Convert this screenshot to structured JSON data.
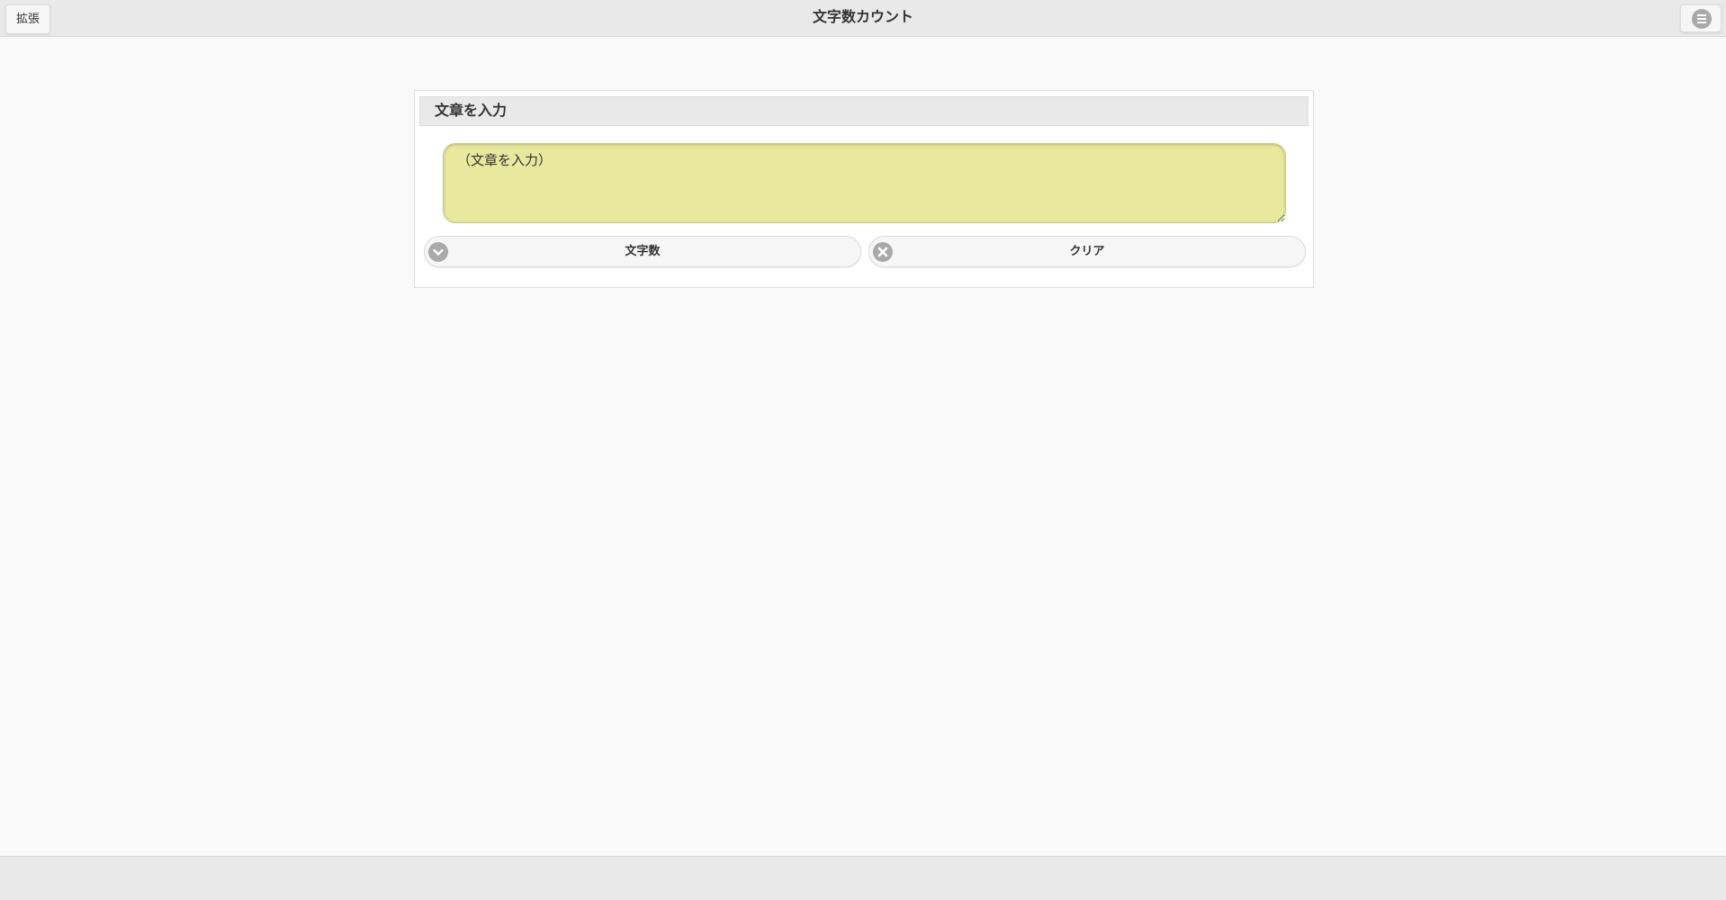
{
  "header": {
    "title": "文字数カウント",
    "expand_label": "拡張",
    "menu_icon": "menu-circle-icon"
  },
  "panel": {
    "heading": "文章を入力",
    "textarea": {
      "placeholder": "（文章を入力）",
      "value": ""
    },
    "buttons": {
      "count_label": "文字数",
      "count_icon": "chevron-down-icon",
      "clear_label": "クリア",
      "clear_icon": "close-icon"
    }
  },
  "colors": {
    "header_bg": "#e9e9e9",
    "page_bg": "#f9f9f9",
    "textarea_bg": "#e8e89e",
    "icon_gray": "#a9a9a9"
  }
}
